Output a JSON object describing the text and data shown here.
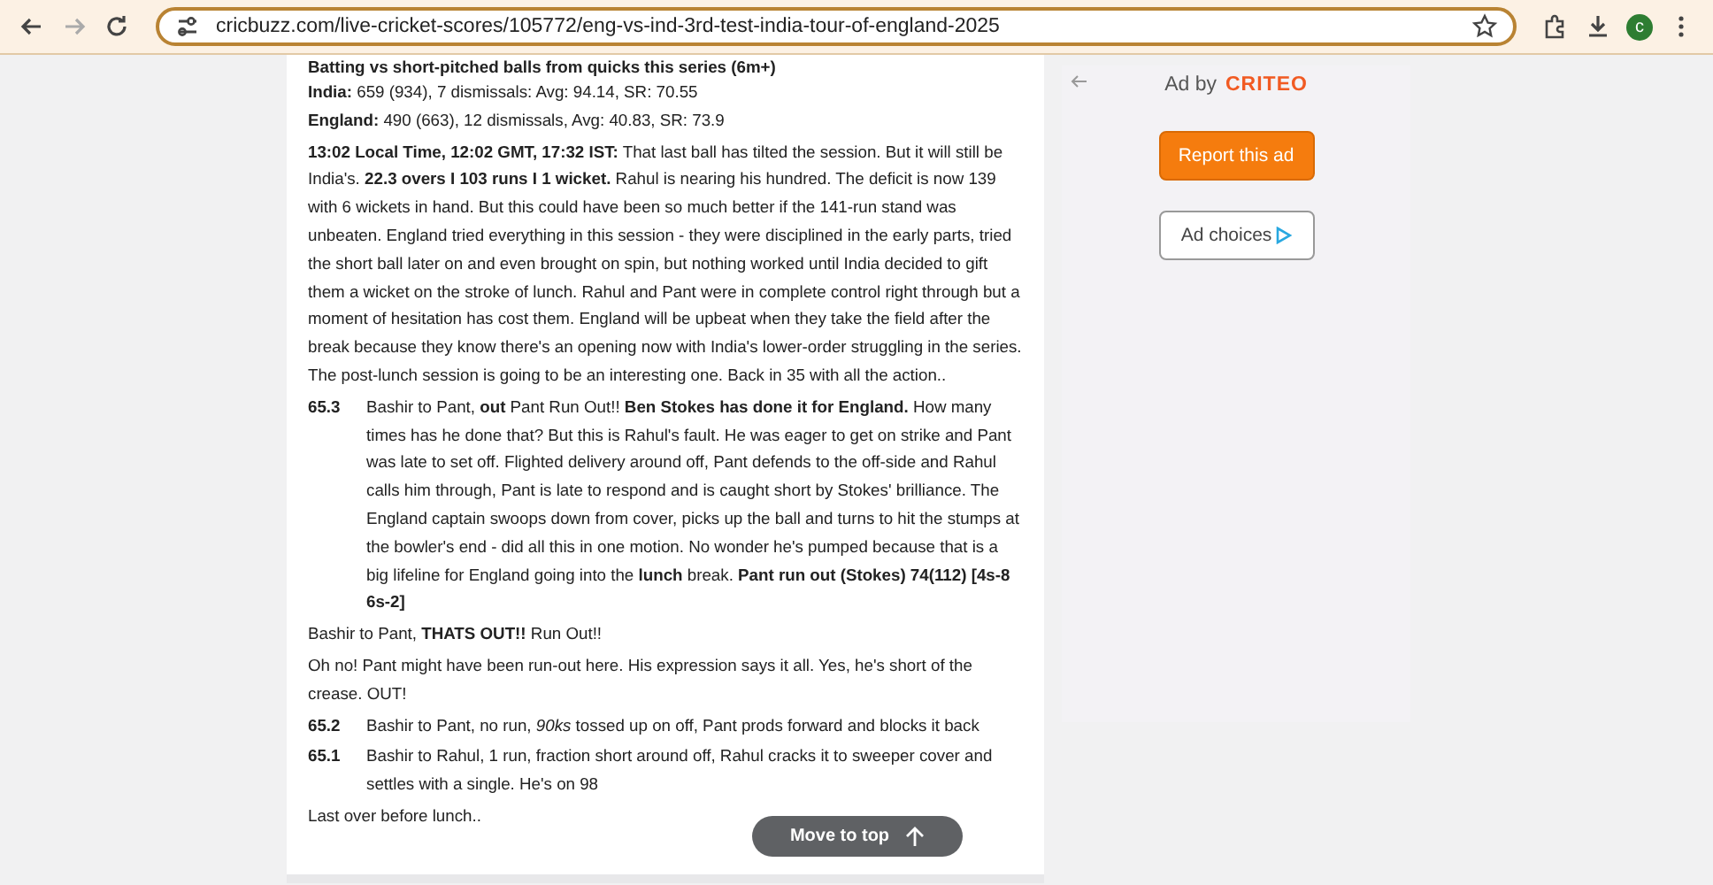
{
  "browser": {
    "url": "cricbuzz.com/live-cricket-scores/105772/eng-vs-ind-3rd-test-india-tour-of-england-2025",
    "profile_initial": "c"
  },
  "stats": [
    {
      "text": "Batting vs short-pitched balls from quicks this series (6m+)",
      "kind": "heading"
    },
    {
      "text": "**India:** 659 (934), 7 dismissals: Avg: 94.14, SR: 70.55",
      "kind": "line"
    },
    {
      "text": "**England:** 490 (663), 12 dismissals, Avg: 40.83, SR: 73.9",
      "kind": "line"
    }
  ],
  "commentary": [
    {
      "kind": "text",
      "text": "**13:02 Local Time, 12:02 GMT, 17:32 IST:** That last ball has tilted the session. But it will still be India's. **22.3 overs I 103 runs I 1 wicket.** Rahul is nearing his hundred. The deficit is now 139 with 6 wickets in hand. But this could have been so much better if the 141-run stand was unbeaten. England tried everything in this session - they were disciplined in the early parts, tried the short ball later on and even brought on spin, but nothing worked until India decided to gift them a wicket on the stroke of lunch. Rahul and Pant were in complete control right through but a moment of hesitation has cost them. England will be upbeat when they take the field after the break because they know there's an opening now with India's lower-order struggling in the series. The post-lunch session is going to be an interesting one. Back in 35 with all the action.."
    },
    {
      "kind": "ball",
      "over": "65.3",
      "text": "Bashir to Pant, **out** Pant Run Out!! **Ben Stokes has done it for England.** How many times has he done that? But this is Rahul's fault. He was eager to get on strike and Pant was late to set off. Flighted delivery around off, Pant defends to the off-side and Rahul calls him through, Pant is late to respond and is caught short by Stokes' brilliance. The England captain swoops down from cover, picks up the ball and turns to hit the stumps at the bowler's end - did all this in one motion. No wonder he's pumped because that is a big lifeline for England going into the **lunch** break. **Pant run out (Stokes) 74(112) [4s-8 6s-2]**"
    },
    {
      "kind": "text",
      "text": "Bashir to Pant, **THATS OUT!!** Run Out!!"
    },
    {
      "kind": "text",
      "text": "Oh no! Pant might have been run-out here. His expression says it all. Yes, he's short of the crease. OUT!"
    },
    {
      "kind": "ball",
      "over": "65.2",
      "text": "Bashir to Pant, no run, *90ks* tossed up on off, Pant prods forward and blocks it back"
    },
    {
      "kind": "ball",
      "over": "65.1",
      "text": "Bashir to Rahul, 1 run, fraction short around off, Rahul cracks it to sweeper cover and settles with a single. He's on 98"
    },
    {
      "kind": "text",
      "text": "Last over before lunch.."
    }
  ],
  "move_to_top": "Move to top",
  "ad": {
    "label": "Ad by",
    "brand": "CRITEO",
    "report": "Report this ad",
    "choices": "Ad choices"
  }
}
